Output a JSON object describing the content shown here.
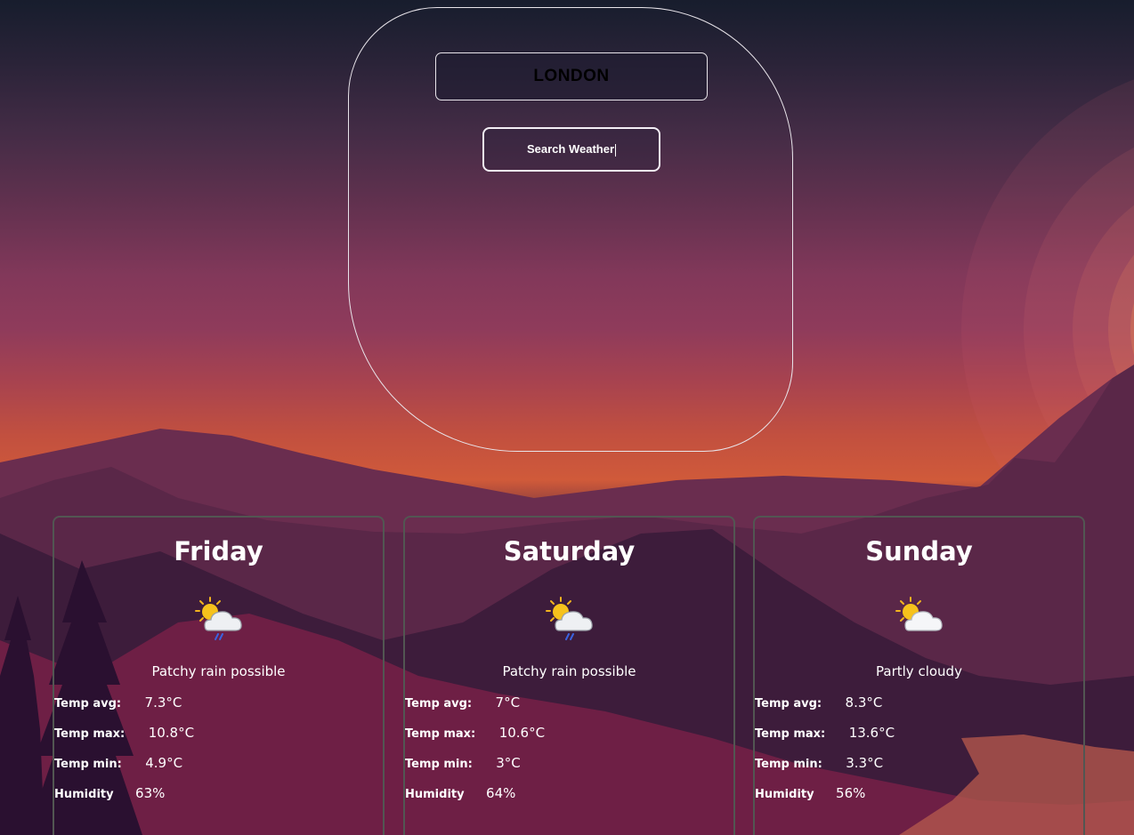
{
  "search": {
    "city_value": "LONDON",
    "button_label": "Search Weather"
  },
  "forecast": [
    {
      "day": "Friday",
      "icon": "patchy-rain-icon",
      "condition": "Patchy rain possible",
      "temp_avg_label": "Temp avg:",
      "temp_avg": "7.3°C",
      "temp_max_label": "Temp max:",
      "temp_max": "10.8°C",
      "temp_min_label": "Temp min:",
      "temp_min": "4.9°C",
      "humidity_label": "Humidity",
      "humidity": "63%"
    },
    {
      "day": "Saturday",
      "icon": "patchy-rain-icon",
      "condition": "Patchy rain possible",
      "temp_avg_label": "Temp avg:",
      "temp_avg": "7°C",
      "temp_max_label": "Temp max:",
      "temp_max": "10.6°C",
      "temp_min_label": "Temp min:",
      "temp_min": "3°C",
      "humidity_label": "Humidity",
      "humidity": "64%"
    },
    {
      "day": "Sunday",
      "icon": "partly-cloudy-icon",
      "condition": "Partly cloudy",
      "temp_avg_label": "Temp avg:",
      "temp_avg": "8.3°C",
      "temp_max_label": "Temp max:",
      "temp_max": "13.6°C",
      "temp_min_label": "Temp min:",
      "temp_min": "3.3°C",
      "humidity_label": "Humidity",
      "humidity": "56%"
    }
  ],
  "colors": {
    "sky_top": "#171d2d",
    "sky_mid": "#8f3b5b",
    "horizon": "#d05a3a",
    "text": "#ffffff",
    "card_border": "#525652"
  }
}
